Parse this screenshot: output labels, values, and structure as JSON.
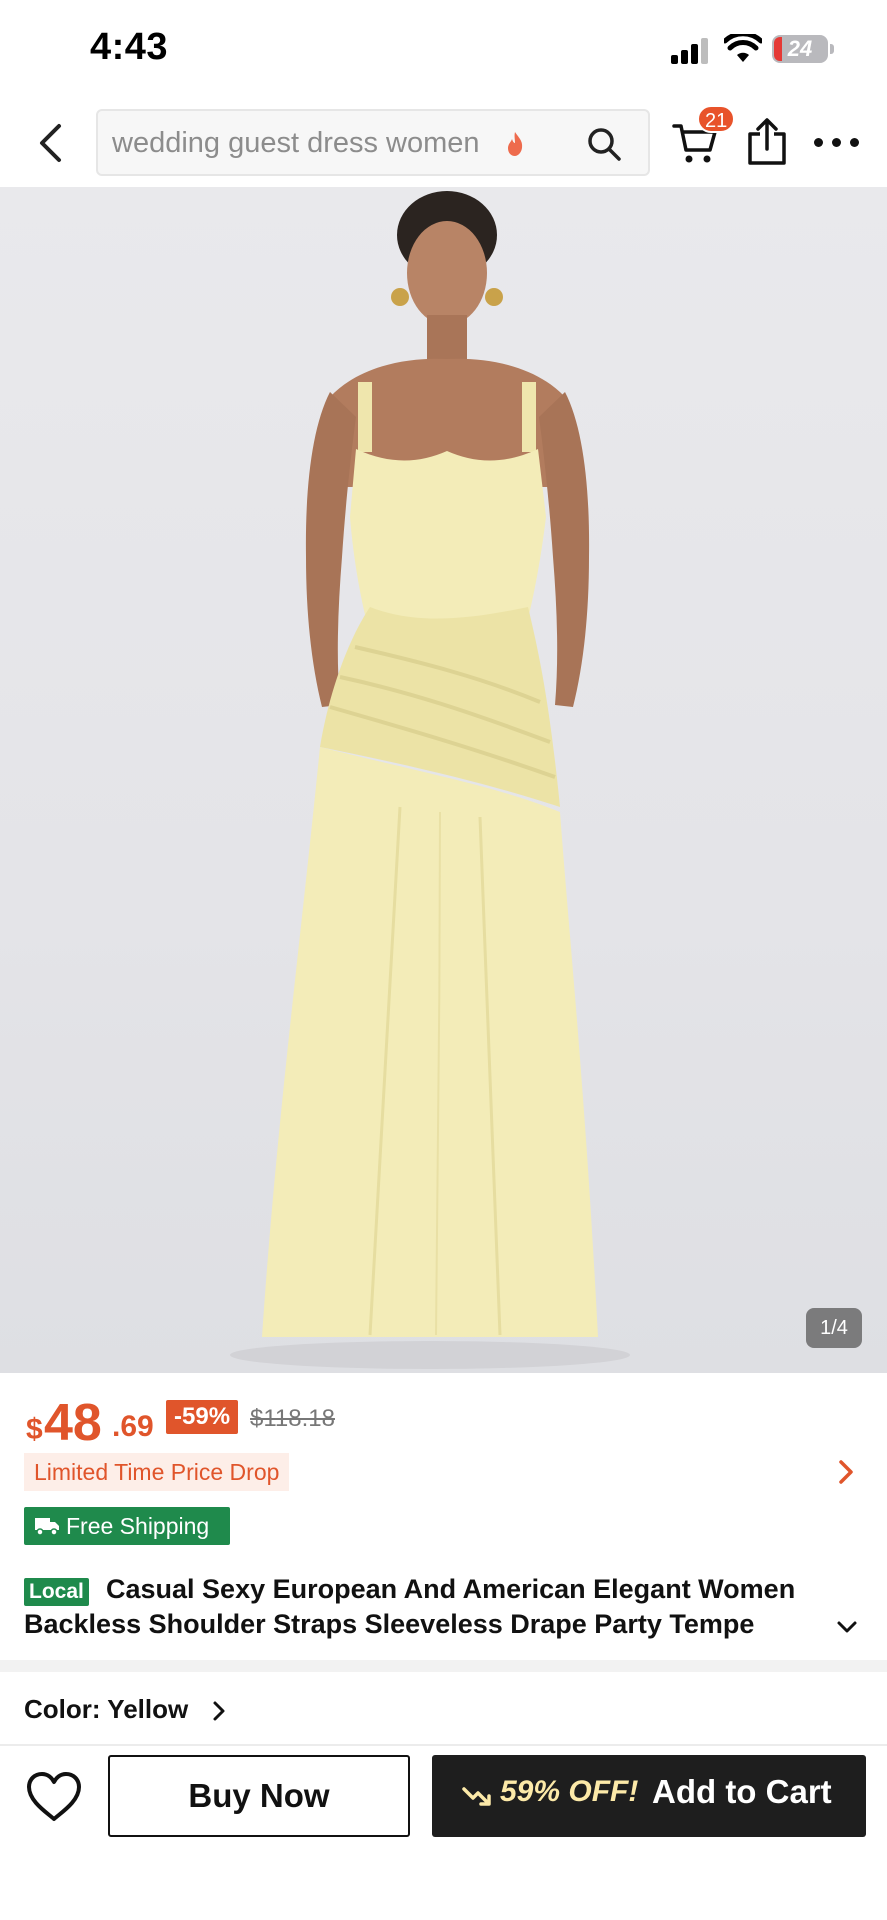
{
  "status_bar": {
    "time": "4:43",
    "battery_level": "24"
  },
  "header": {
    "search_placeholder": "wedding guest dress women",
    "cart_count": "21"
  },
  "gallery": {
    "counter": "1/4",
    "image_alt": "Model wearing a long pale yellow sleeveless draped dress"
  },
  "price": {
    "currency": "$",
    "integer": "48",
    "decimal": ".69",
    "discount": "-59%",
    "original": "$118.18"
  },
  "promo": {
    "label": "Limited Time Price Drop"
  },
  "shipping": {
    "label": "Free Shipping"
  },
  "product": {
    "local_badge": "Local",
    "title_line1": "Casual Sexy European And American Elegant Women",
    "title_line2": "Backless Shoulder Straps Sleeveless Drape Party Tempe"
  },
  "variant": {
    "color_label": "Color: Yellow"
  },
  "actions": {
    "buy_now": "Buy Now",
    "offer": "59% OFF!",
    "add_to_cart": "Add to Cart"
  },
  "colors": {
    "accent": "#e0552b",
    "green": "#1f8a4c",
    "dark_button": "#1e1e1e",
    "offer_text": "#fce9a8",
    "dress": "#f3ecb8"
  }
}
